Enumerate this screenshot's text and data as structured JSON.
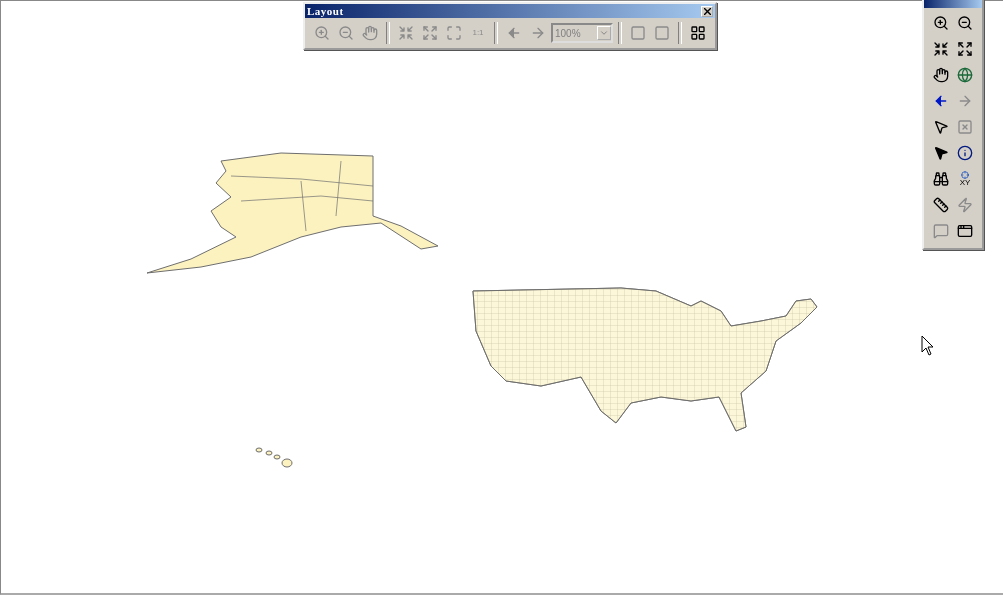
{
  "layout_toolbar": {
    "title": "Layout",
    "zoom_value": "100%",
    "buttons": [
      {
        "kind": "zoom-in",
        "disabled": true
      },
      {
        "kind": "zoom-out",
        "disabled": true
      },
      {
        "kind": "pan",
        "disabled": true
      },
      {
        "kind": "separator"
      },
      {
        "kind": "zoom-in-fixed",
        "disabled": true
      },
      {
        "kind": "zoom-out-fixed",
        "disabled": true
      },
      {
        "kind": "whole-page",
        "disabled": true
      },
      {
        "kind": "one-to-one",
        "label": "1:1",
        "disabled": true
      },
      {
        "kind": "separator"
      },
      {
        "kind": "back",
        "disabled": true
      },
      {
        "kind": "forward",
        "disabled": true
      },
      {
        "kind": "zoom-select"
      },
      {
        "kind": "separator"
      },
      {
        "kind": "toggle-draft",
        "disabled": true
      },
      {
        "kind": "focus-frame",
        "disabled": true
      },
      {
        "kind": "separator"
      },
      {
        "kind": "change-layout",
        "disabled": false
      }
    ]
  },
  "tools_toolbar": {
    "buttons": [
      {
        "kind": "zoom-in",
        "disabled": false
      },
      {
        "kind": "zoom-out",
        "disabled": false
      },
      {
        "kind": "fixed-zoom-in",
        "disabled": false
      },
      {
        "kind": "fixed-zoom-out",
        "disabled": false
      },
      {
        "kind": "pan",
        "disabled": false
      },
      {
        "kind": "full-extent",
        "disabled": false
      },
      {
        "kind": "back",
        "disabled": false
      },
      {
        "kind": "forward",
        "disabled": true
      },
      {
        "kind": "select-features",
        "disabled": false
      },
      {
        "kind": "clear-selection",
        "disabled": true
      },
      {
        "kind": "select-elements",
        "disabled": false
      },
      {
        "kind": "identify",
        "disabled": false
      },
      {
        "kind": "find",
        "disabled": false
      },
      {
        "kind": "go-to-xy",
        "label": "XY",
        "disabled": false
      },
      {
        "kind": "measure",
        "disabled": false
      },
      {
        "kind": "hyperlink",
        "disabled": true
      },
      {
        "kind": "html-popup",
        "disabled": true
      },
      {
        "kind": "viewer-window",
        "disabled": false
      }
    ]
  }
}
